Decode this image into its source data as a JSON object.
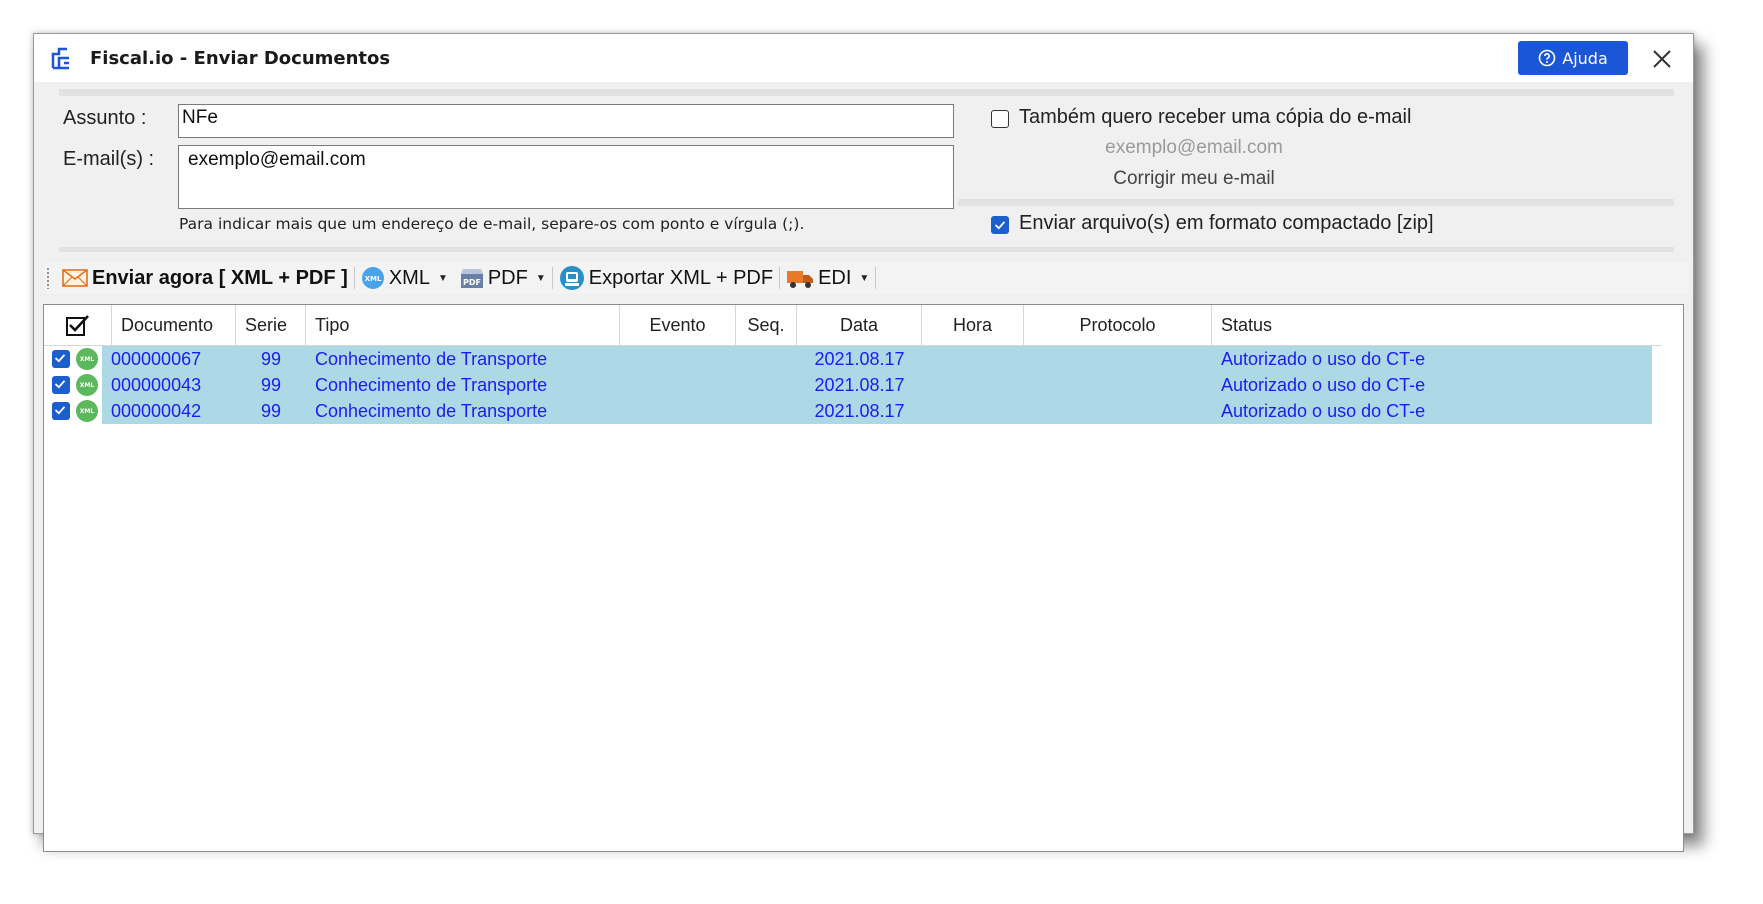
{
  "window": {
    "title": "Fiscal.io - Enviar Documentos",
    "help_label": "Ajuda",
    "accent": "#1a56d6"
  },
  "form": {
    "subject_label": "Assunto :",
    "subject_value": "NFe",
    "emails_label": "E-mail(s) :",
    "emails_value": "exemplo@email.com",
    "hint": "Para indicar mais que um endereço de e-mail, separe-os com ponto e vírgula (;).",
    "copy_label": "Também quero receber uma cópia do e-mail",
    "copy_checked": false,
    "own_email": "exemplo@email.com",
    "fix_email_link": "Corrigir meu e-mail",
    "zip_label": "Enviar arquivo(s) em formato compactado [zip]",
    "zip_checked": true
  },
  "toolbar": {
    "send_now": "Enviar agora [ XML + PDF ]",
    "xml": "XML",
    "pdf": "PDF",
    "export": "Exportar XML + PDF",
    "edi": "EDI"
  },
  "grid": {
    "columns": [
      "Documento",
      "Serie",
      "Tipo",
      "Evento",
      "Seq.",
      "Data",
      "Hora",
      "Protocolo",
      "Status"
    ],
    "rows": [
      {
        "documento": "000000067",
        "serie": "99",
        "tipo": "Conhecimento de Transporte",
        "evento": "",
        "seq": "",
        "data": "2021.08.17",
        "hora": "",
        "protocolo": "",
        "status": "Autorizado o uso do CT-e"
      },
      {
        "documento": "000000043",
        "serie": "99",
        "tipo": "Conhecimento de Transporte",
        "evento": "",
        "seq": "",
        "data": "2021.08.17",
        "hora": "",
        "protocolo": "",
        "status": "Autorizado o uso do CT-e"
      },
      {
        "documento": "000000042",
        "serie": "99",
        "tipo": "Conhecimento de Transporte",
        "evento": "",
        "seq": "",
        "data": "2021.08.17",
        "hora": "",
        "protocolo": "",
        "status": "Autorizado o uso do CT-e"
      }
    ],
    "row_bg": "#add8e6",
    "row_text": "#1c1cf0",
    "xml_badge": "XML"
  }
}
